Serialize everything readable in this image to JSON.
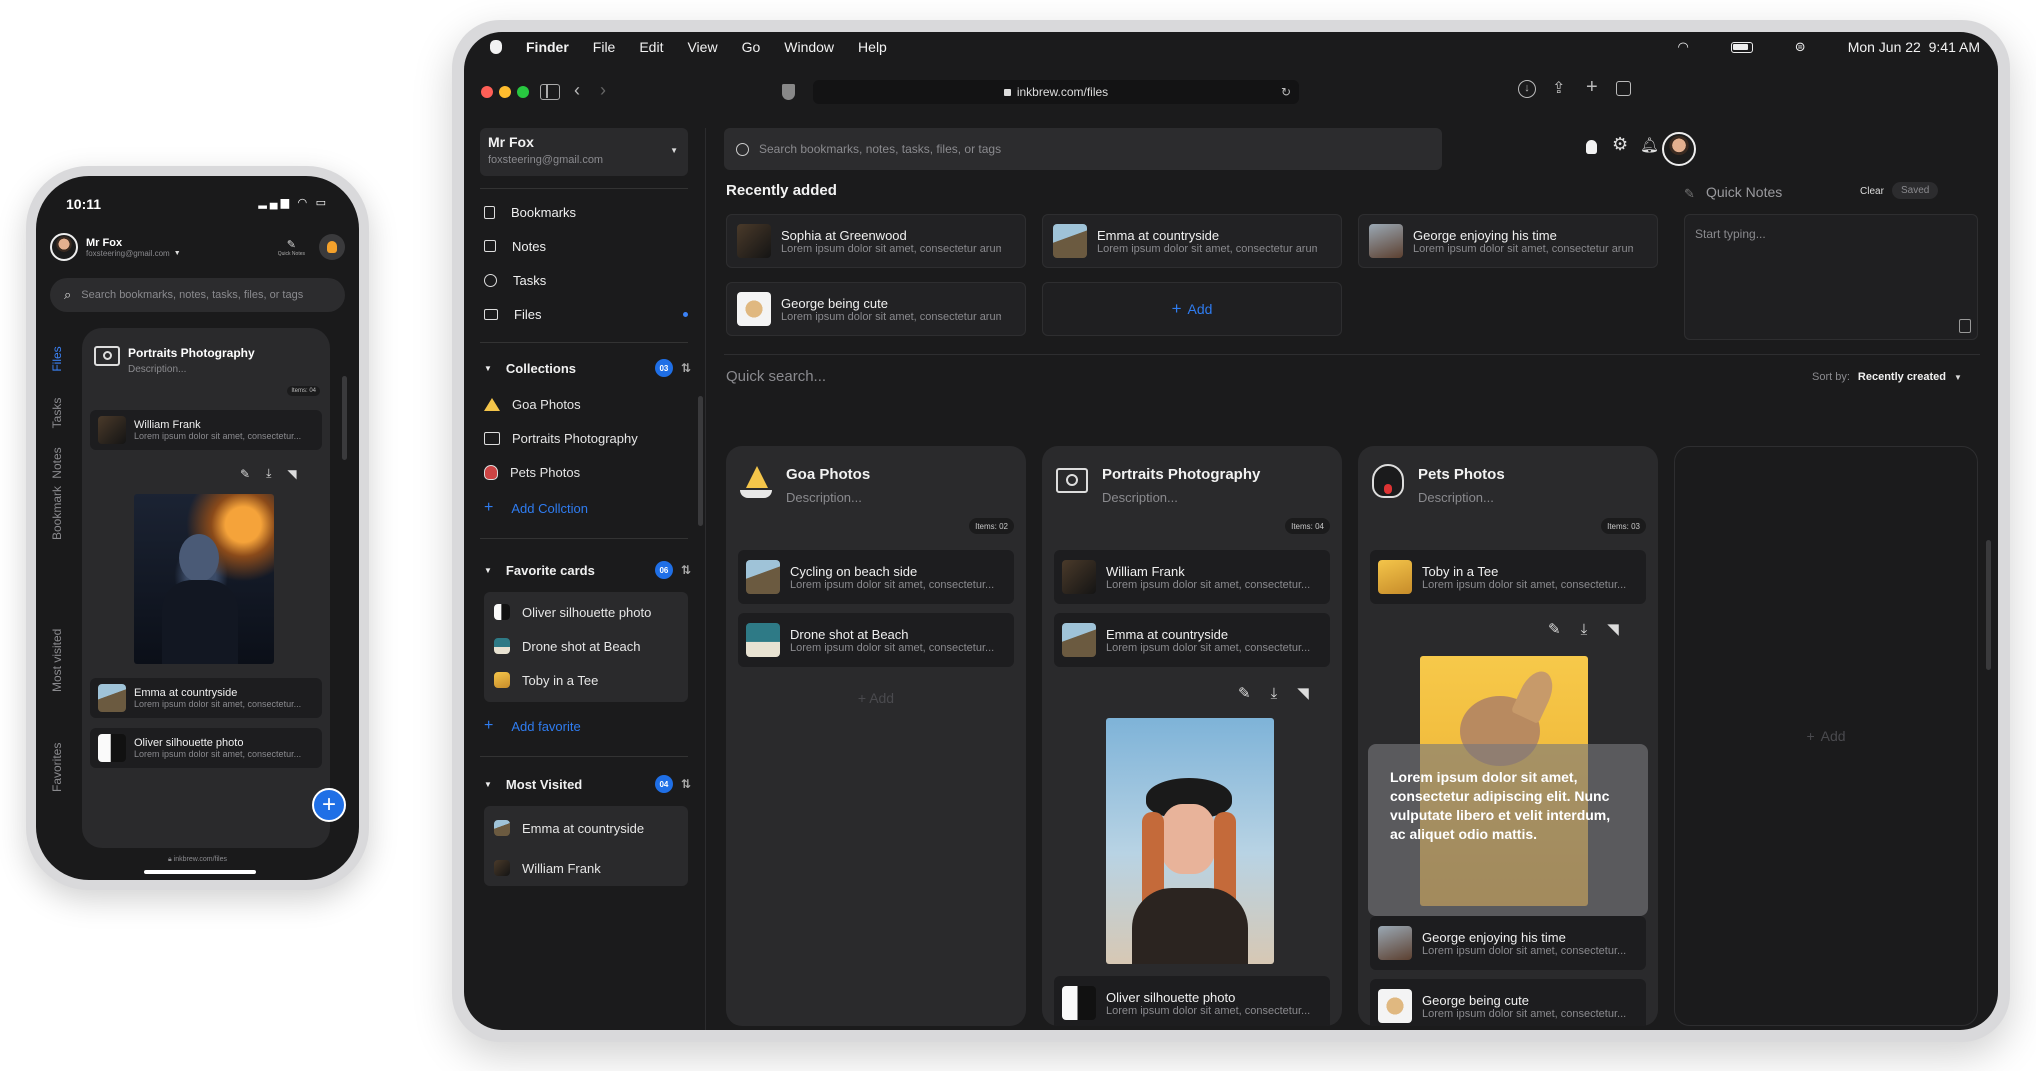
{
  "phone": {
    "time": "10:11",
    "user_name": "Mr Fox",
    "user_email": "foxsteering@gmail.com",
    "quick_notes_label": "Quick Notes",
    "search_placeholder": "Search bookmarks, notes, tasks, files, or tags",
    "side_tabs": [
      "Files",
      "Tasks",
      "Notes",
      "Bookmark",
      "Most visited",
      "Favorites"
    ],
    "collection": {
      "title": "Portraits Photography",
      "description": "Description...",
      "items_badge": "Items: 04",
      "rows": [
        {
          "title": "William Frank",
          "subtitle": "Lorem ipsum dolor sit amet, consectetur..."
        },
        {
          "title": "Emma at countryside",
          "subtitle": "Lorem ipsum dolor sit amet, consectetur..."
        },
        {
          "title": "Oliver silhouette photo",
          "subtitle": "Lorem ipsum dolor sit amet, consectetur..."
        }
      ]
    },
    "url": "inkbrew.com/files"
  },
  "menubar": {
    "app": "Finder",
    "menus": [
      "File",
      "Edit",
      "View",
      "Go",
      "Window",
      "Help"
    ],
    "datetime": "Mon Jun 22  9:41 AM"
  },
  "browser": {
    "url": "inkbrew.com/files"
  },
  "account": {
    "name": "Mr Fox",
    "email": "foxsteering@gmail.com"
  },
  "nav": [
    {
      "label": "Bookmarks",
      "icon": "bookmark-icon"
    },
    {
      "label": "Notes",
      "icon": "note-icon"
    },
    {
      "label": "Tasks",
      "icon": "check-circle-icon"
    },
    {
      "label": "Files",
      "icon": "folder-icon"
    }
  ],
  "collections": {
    "title": "Collections",
    "count": "03",
    "items": [
      "Goa Photos",
      "Portraits Photography",
      "Pets Photos"
    ],
    "add_label": "Add Collction"
  },
  "favorites": {
    "title": "Favorite cards",
    "count": "06",
    "items": [
      "Oliver silhouette photo",
      "Drone shot at Beach",
      "Toby in a Tee"
    ],
    "add_label": "Add favorite"
  },
  "most_visited": {
    "title": "Most Visited",
    "count": "04",
    "items": [
      "Emma at countryside",
      "William Frank"
    ]
  },
  "search": {
    "placeholder": "Search bookmarks, notes, tasks, files, or tags"
  },
  "recent": {
    "title": "Recently added",
    "items": [
      {
        "title": "Sophia at Greenwood",
        "subtitle": "Lorem ipsum dolor sit amet, consectetur arum..."
      },
      {
        "title": "Emma at countryside",
        "subtitle": "Lorem ipsum dolor sit amet, consectetur arum..."
      },
      {
        "title": "George enjoying his time",
        "subtitle": "Lorem ipsum dolor sit amet, consectetur arum..."
      },
      {
        "title": "George being cute",
        "subtitle": "Lorem ipsum dolor sit amet, consectetur arum..."
      }
    ],
    "add_label": "Add"
  },
  "quick_notes": {
    "title": "Quick Notes",
    "clear_label": "Clear",
    "saved_label": "Saved",
    "placeholder": "Start typing..."
  },
  "quick_search": {
    "placeholder": "Quick search...",
    "sort_prefix": "Sort by:",
    "sort_value": "Recently created"
  },
  "columns": [
    {
      "title": "Goa Photos",
      "description": "Description...",
      "items_badge": "Items: 02",
      "rows": [
        {
          "title": "Cycling on beach side",
          "subtitle": "Lorem ipsum dolor sit amet, consectetur..."
        },
        {
          "title": "Drone shot at Beach",
          "subtitle": "Lorem ipsum dolor sit amet, consectetur..."
        }
      ],
      "add_label": "Add"
    },
    {
      "title": "Portraits Photography",
      "description": "Description...",
      "items_badge": "Items: 04",
      "rows": [
        {
          "title": "William Frank",
          "subtitle": "Lorem ipsum dolor sit amet, consectetur..."
        },
        {
          "title": "Emma at countryside",
          "subtitle": "Lorem ipsum dolor sit amet, consectetur..."
        },
        {
          "title": "Oliver silhouette photo",
          "subtitle": "Lorem ipsum dolor sit amet, consectetur..."
        }
      ]
    },
    {
      "title": "Pets Photos",
      "description": "Description...",
      "items_badge": "Items: 03",
      "rows": [
        {
          "title": "Toby in a Tee",
          "subtitle": "Lorem ipsum dolor sit amet, consectetur..."
        },
        {
          "title": "George enjoying his time",
          "subtitle": "Lorem ipsum dolor sit amet, consectetur..."
        },
        {
          "title": "George being cute",
          "subtitle": "Lorem ipsum dolor sit amet, consectetur..."
        }
      ],
      "tooltip": "Lorem ipsum dolor sit amet, consectetur adipiscing elit. Nunc vulputate libero et velit interdum, ac aliquet odio mattis."
    }
  ],
  "empty_column": {
    "add_label": "Add"
  },
  "colors": {
    "accent": "#1f6fe6",
    "background": "#1b1b1c",
    "card": "#2a2a2c"
  }
}
